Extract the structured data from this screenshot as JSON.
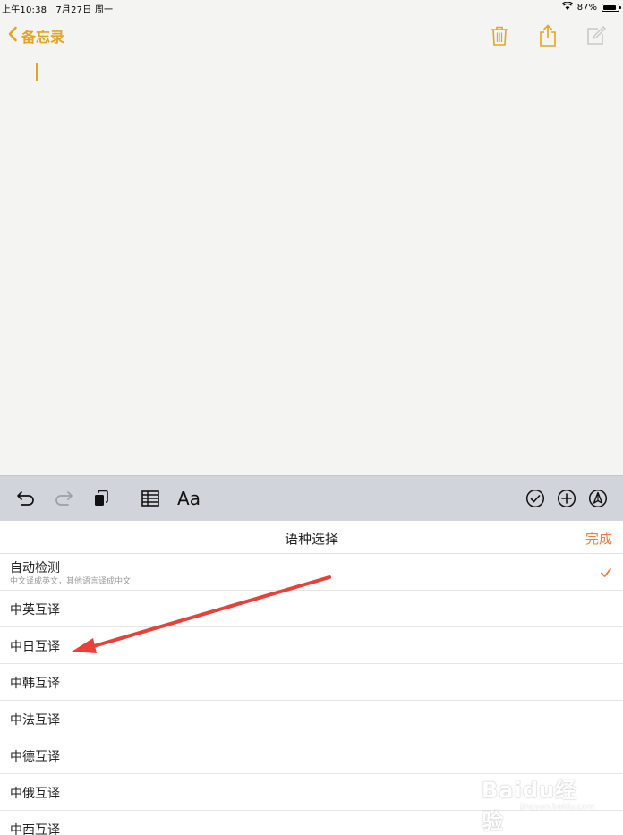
{
  "status_bar": {
    "time": "上午10:38",
    "date": "7月27日 周一",
    "battery_percent": "87%",
    "battery_level": 0.87
  },
  "nav": {
    "back_label": "备忘录",
    "icons": [
      "trash-icon",
      "share-icon",
      "compose-icon"
    ],
    "accent_color": "#e5a521"
  },
  "toolbar": {
    "format_label": "Aa",
    "icons": [
      "undo-icon",
      "redo-icon",
      "copy-icon",
      "table-icon",
      "checklist-icon",
      "add-icon",
      "markup-icon"
    ]
  },
  "sheet": {
    "title": "语种选择",
    "done_label": "完成",
    "done_color": "#f07b3a",
    "options": [
      {
        "label": "自动检测",
        "sub": "中文译成英文，其他语言译成中文",
        "selected": true
      },
      {
        "label": "中英互译"
      },
      {
        "label": "中日互译"
      },
      {
        "label": "中韩互译"
      },
      {
        "label": "中法互译"
      },
      {
        "label": "中德互译"
      },
      {
        "label": "中俄互译"
      },
      {
        "label": "中西互译"
      }
    ]
  },
  "watermark": {
    "logo": "Baidu经验",
    "url": "jingyan.baidu.com"
  }
}
